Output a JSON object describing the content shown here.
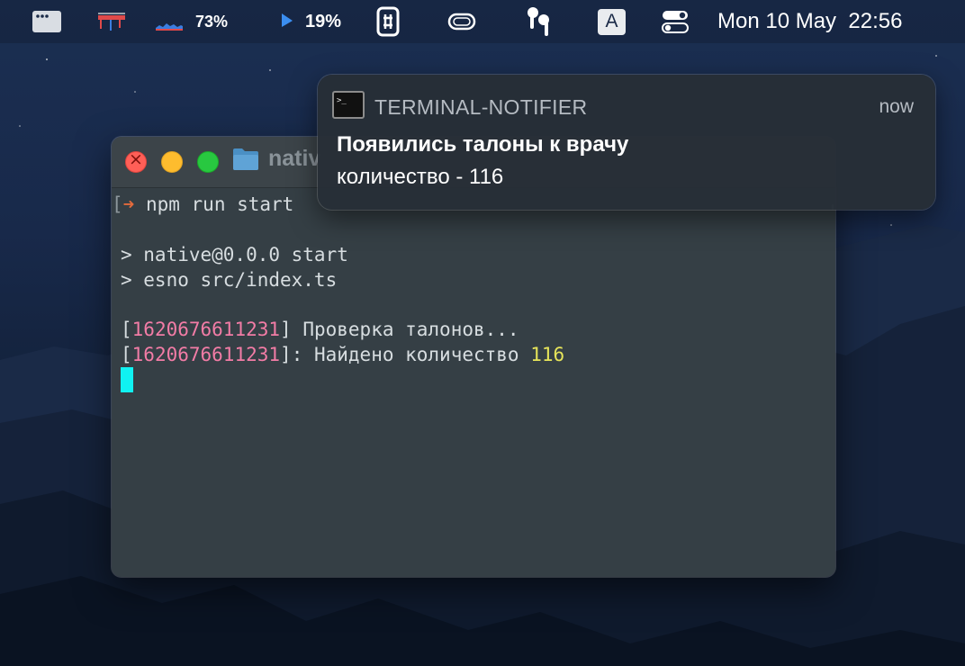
{
  "menubar": {
    "battery_percent": "73%",
    "cpu_percent": "19%",
    "input_source": "A",
    "clock": "Mon 10 May  22:56"
  },
  "terminal": {
    "title": "nativ",
    "lines": {
      "prompt_command": "npm run start",
      "script_line": "> native@0.0.0 start",
      "exec_line": "> esno src/index.ts",
      "log1_timestamp": "1620676611231",
      "log1_text": " Проверка талонов...",
      "log2_timestamp": "1620676611231",
      "log2_text": ": Найдено количество ",
      "log2_count": "116"
    }
  },
  "notification": {
    "app_name": "TERMINAL-NOTIFIER",
    "time": "now",
    "title": "Появились талоны к врачу",
    "message": "количество - 116"
  },
  "colors": {
    "timestamp": "#f27ca6",
    "count": "#e6e45a",
    "cursor": "#10f2f2",
    "close": "#ff5f57",
    "minimize": "#febc2e",
    "zoom": "#28c840"
  },
  "icons": {
    "menubar": [
      "window-switcher-icon",
      "network-activity-icon",
      "battery-graph-icon",
      "cpu-arrow-icon",
      "power-plug-icon",
      "display-toggle-icon",
      "airpods-icon",
      "input-source-icon",
      "control-center-icon"
    ],
    "terminal": [
      "folder-icon"
    ],
    "notification": [
      "terminal-app-icon"
    ]
  }
}
